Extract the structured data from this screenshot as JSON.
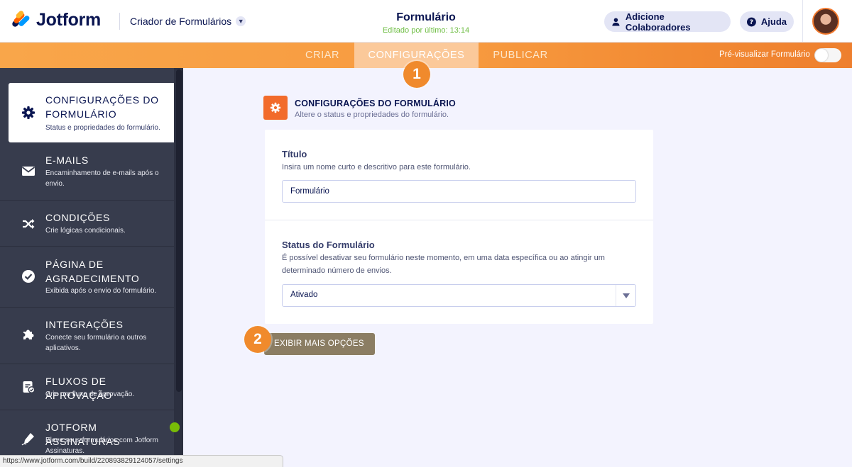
{
  "header": {
    "brand": "Jotform",
    "builder_label": "Criador de Formulários",
    "form_title": "Formulário",
    "edited": "Editado por último: 13:14",
    "collaborators_button": "Adicione Colaboradores",
    "help_button": "Ajuda"
  },
  "nav": {
    "tabs": [
      {
        "label": "CRIAR"
      },
      {
        "label": "CONFIGURAÇÕES"
      },
      {
        "label": "PUBLICAR"
      }
    ],
    "active_tab": "CONFIGURAÇÕES",
    "preview_label": "Pré-visualizar Formulário",
    "preview_enabled": false
  },
  "badges": [
    "1",
    "2"
  ],
  "sidebar": {
    "items": [
      {
        "title_line1": "CONFIGURAÇÕES DO",
        "title_line2": "FORMULÁRIO",
        "desc_line1": "Status e propriedades do formulário.",
        "icon": "gear-icon"
      },
      {
        "title_line1": "E-MAILS",
        "desc_line1": "Encaminhamento de e-mails após o",
        "desc_line2": "envio.",
        "icon": "envelope-icon"
      },
      {
        "title_line1": "CONDIÇÕES",
        "desc_line1": "Crie lógicas condicionais.",
        "icon": "shuffle-icon"
      },
      {
        "title_line1": "PÁGINA DE",
        "title_line2": "AGRADECIMENTO",
        "desc_line1": "Exibida após o envio do formulário.",
        "icon": "check-circle-icon"
      },
      {
        "title_line1": "INTEGRAÇÕES",
        "desc_line1": "Conecte seu formulário a outros",
        "desc_line2": "aplicativos.",
        "icon": "puzzle-icon"
      },
      {
        "title_line1": "FLUXOS DE APROVAÇÃO",
        "desc_line1": "Crie um fluxo de aprovação.",
        "icon": "approval-icon"
      },
      {
        "title_line1": "JOTFORM ASSINATURAS",
        "desc_line1": "Eleve seus formulários com Jotform",
        "desc_line2": "Assinaturas.",
        "icon": "pen-icon"
      }
    ]
  },
  "main": {
    "section_title": "CONFIGURAÇÕES DO FORMULÁRIO",
    "section_subtitle": "Altere o status e propriedades do formulário.",
    "title_field": {
      "label": "Título",
      "help": "Insira um nome curto e descritivo para este formulário.",
      "value": "Formulário"
    },
    "status_field": {
      "label": "Status do Formulário",
      "help_line1": "É possível desativar seu formulário neste momento, em uma data específica ou ao atingir um",
      "help_line2": "determinado número de envios.",
      "selected": "Ativado"
    },
    "more_options_button": "EXIBIR MAIS OPÇÕES"
  },
  "status_bar": {
    "url": "https://www.jotform.com/build/220893829124057/settings"
  },
  "colors": {
    "brand_orange": "#f08a2c",
    "sidebar_bg": "#373c4d",
    "navy_text": "#0a1551",
    "edited_green": "#6fbe44",
    "more_button": "#8b7d63"
  }
}
